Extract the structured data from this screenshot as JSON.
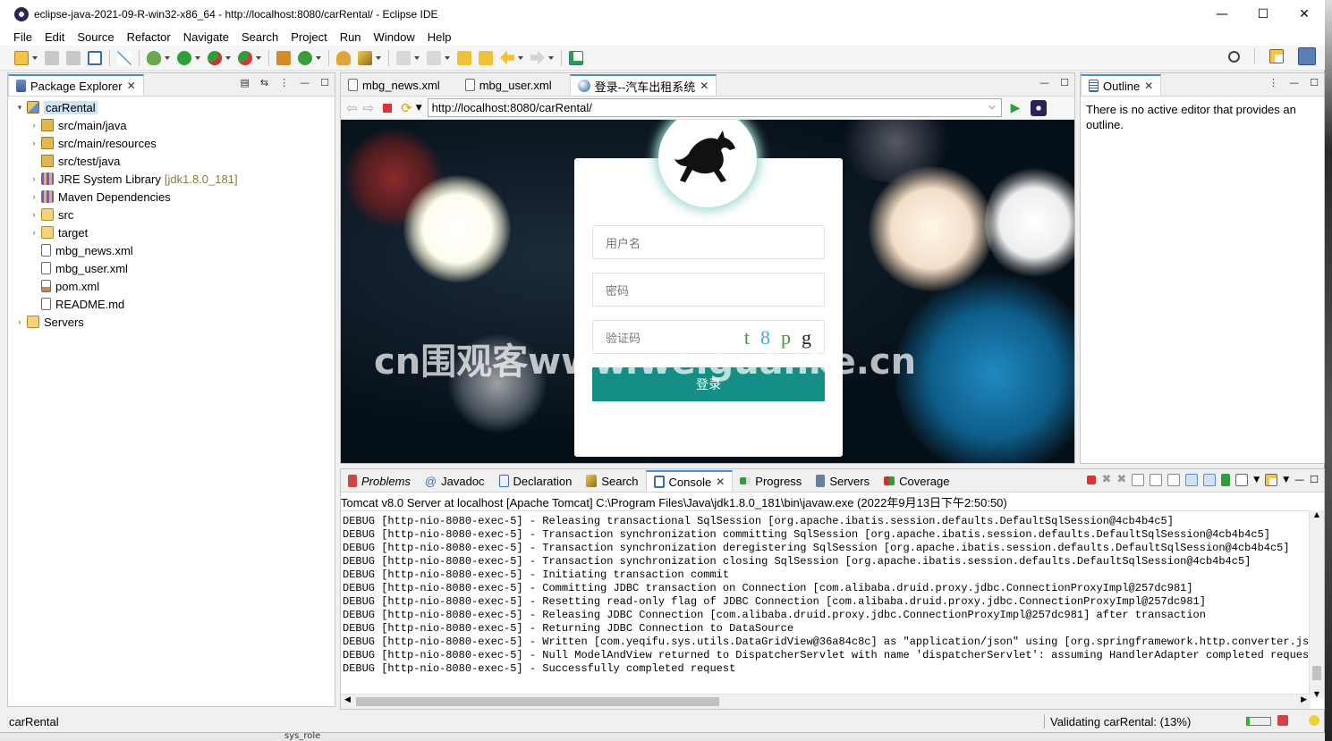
{
  "window": {
    "title": "eclipse-java-2021-09-R-win32-x86_64 - http://localhost:8080/carRental/ - Eclipse IDE",
    "minimize": "—",
    "maximize": "☐",
    "close": "✕"
  },
  "menu": [
    "File",
    "Edit",
    "Source",
    "Refactor",
    "Navigate",
    "Search",
    "Project",
    "Run",
    "Window",
    "Help"
  ],
  "package_explorer": {
    "tab_label": "Package Explorer",
    "items": [
      {
        "label": "carRental",
        "indent": 0,
        "twisty": "▾",
        "icon": "project-icon",
        "selected": true
      },
      {
        "label": "src/main/java",
        "indent": 1,
        "twisty": "›",
        "icon": "source-folder-icon"
      },
      {
        "label": "src/main/resources",
        "indent": 1,
        "twisty": "›",
        "icon": "source-folder-icon"
      },
      {
        "label": "src/test/java",
        "indent": 1,
        "twisty": "",
        "icon": "source-folder-icon"
      },
      {
        "label": "JRE System Library",
        "decoration": "[jdk1.8.0_181]",
        "indent": 1,
        "twisty": "›",
        "icon": "library-icon"
      },
      {
        "label": "Maven Dependencies",
        "indent": 1,
        "twisty": "›",
        "icon": "library-icon"
      },
      {
        "label": "src",
        "indent": 1,
        "twisty": "›",
        "icon": "folder-icon"
      },
      {
        "label": "target",
        "indent": 1,
        "twisty": "›",
        "icon": "folder-icon"
      },
      {
        "label": "mbg_news.xml",
        "indent": 1,
        "twisty": "",
        "icon": "xml-file-icon"
      },
      {
        "label": "mbg_user.xml",
        "indent": 1,
        "twisty": "",
        "icon": "xml-file-icon"
      },
      {
        "label": "pom.xml",
        "indent": 1,
        "twisty": "",
        "icon": "maven-file-icon"
      },
      {
        "label": "README.md",
        "indent": 1,
        "twisty": "",
        "icon": "markdown-file-icon"
      },
      {
        "label": "Servers",
        "indent": 0,
        "twisty": "›",
        "icon": "folder-icon"
      }
    ]
  },
  "editor": {
    "tabs": [
      {
        "label": "mbg_news.xml",
        "icon": "xml-file-icon",
        "active": false
      },
      {
        "label": "mbg_user.xml",
        "icon": "xml-file-icon",
        "active": false
      },
      {
        "label": "登录--汽车出租系统",
        "icon": "globe-icon",
        "active": true
      }
    ],
    "url": "http://localhost:8080/carRental/"
  },
  "login_page": {
    "username_placeholder": "用户名",
    "password_placeholder": "密码",
    "captcha_placeholder": "验证码",
    "captcha_chars": [
      "t",
      "8",
      "p",
      "g"
    ],
    "captcha_colors": [
      "#3d9b3d",
      "#48a9c8",
      "#3d9b3d",
      "#222222"
    ],
    "login_button": "登录",
    "watermark": "cn围观客www.weiguanke.cn"
  },
  "outline": {
    "tab_label": "Outline",
    "message": "There is no active editor that provides an outline."
  },
  "bottom_panel": {
    "tabs": [
      {
        "label": "Problems",
        "icon": "problems-icon",
        "italic": true
      },
      {
        "label": "Javadoc",
        "icon": "javadoc-icon",
        "italic": false
      },
      {
        "label": "Declaration",
        "icon": "declaration-icon",
        "italic": false
      },
      {
        "label": "Search",
        "icon": "search-icon",
        "italic": false
      },
      {
        "label": "Console",
        "icon": "console-icon",
        "active": true
      },
      {
        "label": "Progress",
        "icon": "progress-icon",
        "italic": false
      },
      {
        "label": "Servers",
        "icon": "servers-icon",
        "italic": false
      },
      {
        "label": "Coverage",
        "icon": "coverage-icon",
        "italic": false
      }
    ],
    "console_header": "Tomcat v8.0 Server at localhost [Apache Tomcat] C:\\Program Files\\Java\\jdk1.8.0_181\\bin\\javaw.exe  (2022年9月13日下午2:50:50)",
    "console_lines": [
      "DEBUG [http-nio-8080-exec-5] - Releasing transactional SqlSession [org.apache.ibatis.session.defaults.DefaultSqlSession@4cb4b4c5]",
      "DEBUG [http-nio-8080-exec-5] - Transaction synchronization committing SqlSession [org.apache.ibatis.session.defaults.DefaultSqlSession@4cb4b4c5]",
      "DEBUG [http-nio-8080-exec-5] - Transaction synchronization deregistering SqlSession [org.apache.ibatis.session.defaults.DefaultSqlSession@4cb4b4c5]",
      "DEBUG [http-nio-8080-exec-5] - Transaction synchronization closing SqlSession [org.apache.ibatis.session.defaults.DefaultSqlSession@4cb4b4c5]",
      "DEBUG [http-nio-8080-exec-5] - Initiating transaction commit",
      "DEBUG [http-nio-8080-exec-5] - Committing JDBC transaction on Connection [com.alibaba.druid.proxy.jdbc.ConnectionProxyImpl@257dc981]",
      "DEBUG [http-nio-8080-exec-5] - Resetting read-only flag of JDBC Connection [com.alibaba.druid.proxy.jdbc.ConnectionProxyImpl@257dc981]",
      "DEBUG [http-nio-8080-exec-5] - Releasing JDBC Connection [com.alibaba.druid.proxy.jdbc.ConnectionProxyImpl@257dc981] after transaction",
      "DEBUG [http-nio-8080-exec-5] - Returning JDBC Connection to DataSource",
      "DEBUG [http-nio-8080-exec-5] - Written [com.yeqifu.sys.utils.DataGridView@36a84c8c] as \"application/json\" using [org.springframework.http.converter.json.Ma",
      "DEBUG [http-nio-8080-exec-5] - Null ModelAndView returned to DispatcherServlet with name 'dispatcherServlet': assuming HandlerAdapter completed request har",
      "DEBUG [http-nio-8080-exec-5] - Successfully completed request"
    ]
  },
  "status": {
    "selection": "carRental",
    "task": "Validating carRental: (13%)",
    "progress_fraction": 0.13
  },
  "taskbar_peek": "sys_role",
  "colors": {
    "accent": "#4d8fd6",
    "login_button": "#158f85",
    "selection": "#cce4f7"
  }
}
